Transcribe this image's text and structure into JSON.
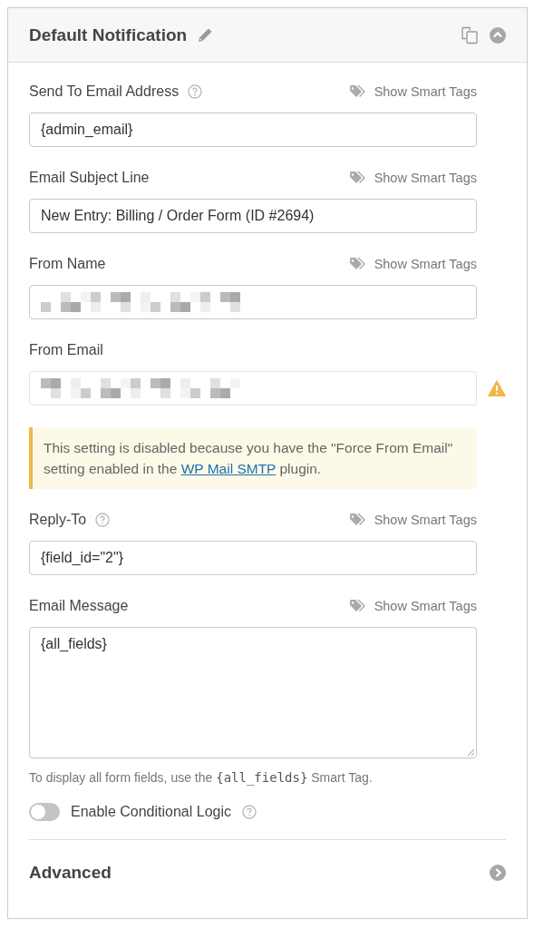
{
  "panel": {
    "title": "Default Notification",
    "expanded": true
  },
  "fields": [
    {
      "label": "Send To Email Address",
      "help": true,
      "smart_tags": "Show Smart Tags",
      "kind": "text",
      "value": "{admin_email}",
      "disabled": false
    },
    {
      "label": "Email Subject Line",
      "help": false,
      "smart_tags": "Show Smart Tags",
      "kind": "text",
      "value": "New Entry: Billing / Order Form (ID #2694)",
      "disabled": false
    },
    {
      "label": "From Name",
      "help": false,
      "smart_tags": "Show Smart Tags",
      "kind": "redacted",
      "disabled": false
    },
    {
      "label": "From Email",
      "help": false,
      "kind": "redacted",
      "disabled": true,
      "warning": true,
      "notice": [
        {
          "kind": "text",
          "text": "This setting is disabled because you have the \"Force From Email\" setting enabled in the "
        },
        {
          "kind": "link",
          "text": "WP Mail SMTP"
        },
        {
          "kind": "text",
          "text": " plugin."
        }
      ]
    },
    {
      "label": "Reply-To",
      "help": true,
      "smart_tags": "Show Smart Tags",
      "kind": "text",
      "value": "{field_id=\"2\"}",
      "disabled": false
    },
    {
      "label": "Email Message",
      "help": false,
      "smart_tags": "Show Smart Tags",
      "kind": "textarea",
      "value": "{all_fields}",
      "hint": [
        {
          "kind": "text",
          "text": "To display all form fields, use the "
        },
        {
          "kind": "code",
          "text": "{all_fields}"
        },
        {
          "kind": "text",
          "text": " Smart Tag."
        }
      ]
    }
  ],
  "conditional_logic": {
    "label": "Enable Conditional Logic",
    "on": false,
    "help": true
  },
  "advanced": {
    "title": "Advanced",
    "expanded": false
  }
}
